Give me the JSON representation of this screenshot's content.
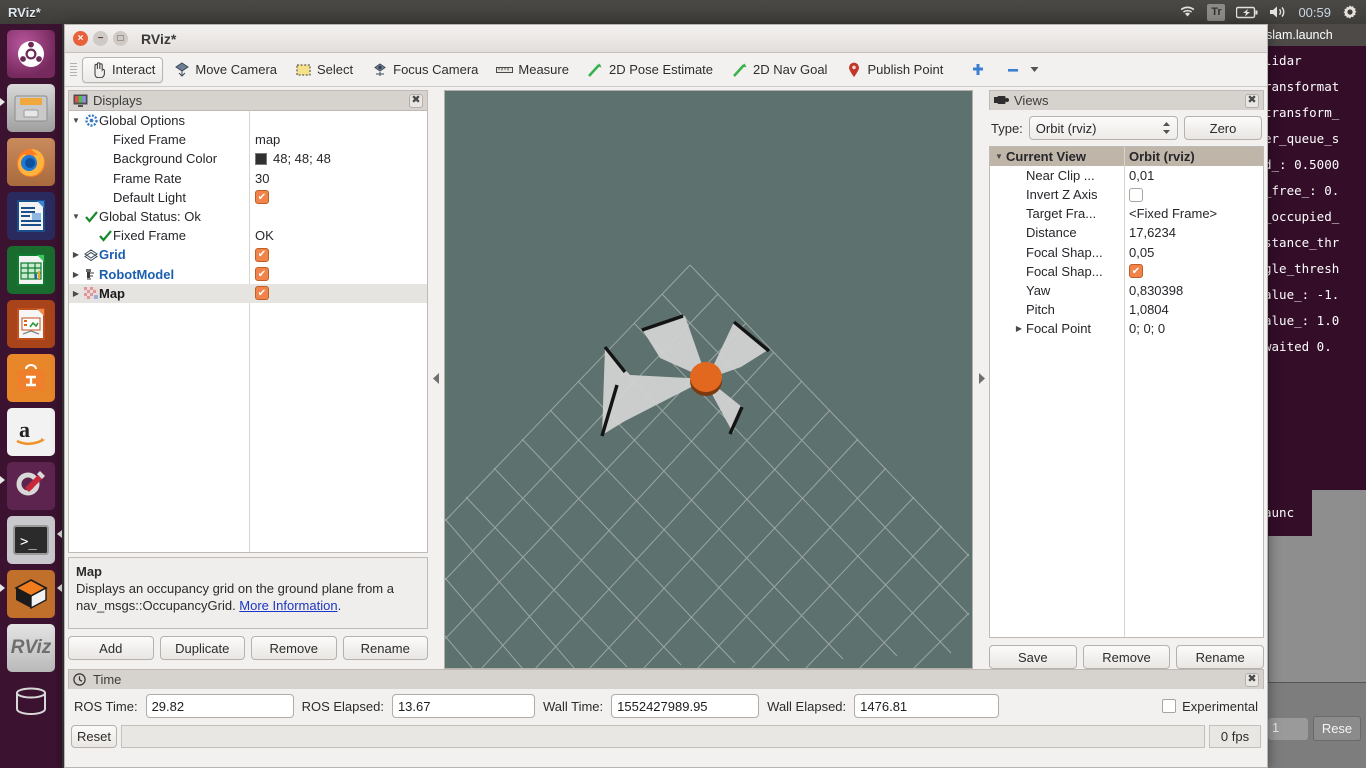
{
  "top_panel": {
    "app_title": "RViz*",
    "clock": "00:59",
    "indicators": [
      "wifi-icon",
      "keyboard-layout-Tr",
      "battery-icon",
      "volume-icon",
      "gear-icon"
    ],
    "keyboard_layout": "Tr"
  },
  "launcher": {
    "items": [
      {
        "name": "ubuntu-dash",
        "label": "Ubuntu"
      },
      {
        "name": "files",
        "label": "Files"
      },
      {
        "name": "firefox",
        "label": "Firefox"
      },
      {
        "name": "libreoffice-writer",
        "label": "LibreOffice Writer"
      },
      {
        "name": "libreoffice-calc",
        "label": "LibreOffice Calc"
      },
      {
        "name": "libreoffice-impress",
        "label": "LibreOffice Impress"
      },
      {
        "name": "ubuntu-software",
        "label": "Ubuntu Software"
      },
      {
        "name": "amazon",
        "label": "Amazon"
      },
      {
        "name": "system-settings",
        "label": "System Settings"
      },
      {
        "name": "terminal",
        "label": "Terminal"
      },
      {
        "name": "gazebo",
        "label": "Gazebo"
      },
      {
        "name": "rviz",
        "label": "RViz"
      },
      {
        "name": "trash",
        "label": "Trash"
      }
    ]
  },
  "window": {
    "title": "RViz*",
    "buttons": [
      "close",
      "minimize",
      "maximize"
    ]
  },
  "toolbar": {
    "items": [
      {
        "label": "Interact",
        "icon": "hand-cursor-icon",
        "active": true
      },
      {
        "label": "Move Camera",
        "icon": "move-camera-icon",
        "active": false
      },
      {
        "label": "Select",
        "icon": "select-rect-icon",
        "active": false
      },
      {
        "label": "Focus Camera",
        "icon": "focus-camera-icon",
        "active": false
      },
      {
        "label": "Measure",
        "icon": "ruler-icon",
        "active": false
      },
      {
        "label": "2D Pose Estimate",
        "icon": "green-arrow-icon",
        "active": false
      },
      {
        "label": "2D Nav Goal",
        "icon": "green-arrow-icon",
        "active": false
      },
      {
        "label": "Publish Point",
        "icon": "map-pin-icon",
        "active": false
      }
    ],
    "plus_label": "+",
    "minus_label": "−"
  },
  "displays_panel": {
    "title": "Displays",
    "close_label": "✖",
    "rows": [
      {
        "indent": 0,
        "arrow": "▼",
        "icon": "gear-icon",
        "label": "Global Options",
        "label_style": "plain",
        "value_type": "none",
        "value": "",
        "selected": false
      },
      {
        "indent": 1,
        "arrow": "",
        "icon": "none",
        "label": "Fixed Frame",
        "label_style": "plain",
        "value_type": "text",
        "value": "map",
        "selected": false
      },
      {
        "indent": 1,
        "arrow": "",
        "icon": "none",
        "label": "Background Color",
        "label_style": "plain",
        "value_type": "color",
        "value": "48; 48; 48",
        "color": "#303030",
        "selected": false
      },
      {
        "indent": 1,
        "arrow": "",
        "icon": "none",
        "label": "Frame Rate",
        "label_style": "plain",
        "value_type": "text",
        "value": "30",
        "selected": false
      },
      {
        "indent": 1,
        "arrow": "",
        "icon": "none",
        "label": "Default Light",
        "label_style": "plain",
        "value_type": "check",
        "value": "checked",
        "selected": false
      },
      {
        "indent": 0,
        "arrow": "▼",
        "icon": "check-green-icon",
        "label": "Global Status: Ok",
        "label_style": "plain",
        "value_type": "none",
        "value": "",
        "selected": false
      },
      {
        "indent": 1,
        "arrow": "",
        "icon": "check-green-icon",
        "label": "Fixed Frame",
        "label_style": "plain",
        "value_type": "text",
        "value": "OK",
        "selected": false
      },
      {
        "indent": 0,
        "arrow": "▶",
        "icon": "grid-icon",
        "label": "Grid",
        "label_style": "blue",
        "value_type": "check",
        "value": "checked",
        "selected": false
      },
      {
        "indent": 0,
        "arrow": "▶",
        "icon": "robotmodel-icon",
        "label": "RobotModel",
        "label_style": "blue",
        "value_type": "check",
        "value": "checked",
        "selected": false
      },
      {
        "indent": 0,
        "arrow": "▶",
        "icon": "map-grid-icon",
        "label": "Map",
        "label_style": "bold",
        "value_type": "check",
        "value": "checked",
        "selected": true
      }
    ],
    "description": {
      "title": "Map",
      "text_1": "Displays an occupancy grid on the ground plane from a nav_msgs::OccupancyGrid. ",
      "link": "More Information",
      "text_2": "."
    },
    "buttons": [
      "Add",
      "Duplicate",
      "Remove",
      "Rename"
    ]
  },
  "views_panel": {
    "title": "Views",
    "close_label": "✖",
    "type_label": "Type:",
    "type_value": "Orbit (rviz)",
    "zero_label": "Zero",
    "rows": [
      {
        "indent": 0,
        "arrow": "▼",
        "label": "Current View",
        "value": "Orbit (rviz)",
        "header": true,
        "value_type": "text"
      },
      {
        "indent": 1,
        "arrow": "",
        "label": "Near Clip ...",
        "value": "0,01",
        "header": false,
        "value_type": "text"
      },
      {
        "indent": 1,
        "arrow": "",
        "label": "Invert Z Axis",
        "value": "",
        "header": false,
        "value_type": "check-off"
      },
      {
        "indent": 1,
        "arrow": "",
        "label": "Target Fra...",
        "value": "<Fixed Frame>",
        "header": false,
        "value_type": "text"
      },
      {
        "indent": 1,
        "arrow": "",
        "label": "Distance",
        "value": "17,6234",
        "header": false,
        "value_type": "text"
      },
      {
        "indent": 1,
        "arrow": "",
        "label": "Focal Shap...",
        "value": "0,05",
        "header": false,
        "value_type": "text"
      },
      {
        "indent": 1,
        "arrow": "",
        "label": "Focal Shap...",
        "value": "",
        "header": false,
        "value_type": "check"
      },
      {
        "indent": 1,
        "arrow": "",
        "label": "Yaw",
        "value": "0,830398",
        "header": false,
        "value_type": "text"
      },
      {
        "indent": 1,
        "arrow": "",
        "label": "Pitch",
        "value": "1,0804",
        "header": false,
        "value_type": "text"
      },
      {
        "indent": 1,
        "arrow": "▶",
        "label": "Focal Point",
        "value": "0; 0; 0",
        "header": false,
        "value_type": "text"
      }
    ],
    "buttons": [
      "Save",
      "Remove",
      "Rename"
    ]
  },
  "time_panel": {
    "title": "Time",
    "close_label": "✖",
    "fields": [
      {
        "label": "ROS Time:",
        "value": "29.82"
      },
      {
        "label": "ROS Elapsed:",
        "value": "13.67"
      },
      {
        "label": "Wall Time:",
        "value": "1552427989.95"
      },
      {
        "label": "Wall Elapsed:",
        "value": "1476.81"
      }
    ],
    "experimental_label": "Experimental",
    "experimental_checked": false,
    "reset_label": "Reset",
    "fps_label": "0 fps"
  },
  "terminal": {
    "tab_title": "slam.launch",
    "lines": [
      "lidar",
      "ransformat",
      "transform_",
      "er_queue_s",
      "d_: 0.5000",
      "_free_: 0.",
      "_occupied_",
      "stance_thr",
      "gle_thresh",
      "alue_: -1.",
      "alue_: 1.0",
      " waited 0."
    ],
    "lower_fragment": "aunc"
  },
  "background_window": {
    "reset_label": "Rese",
    "field_value": "1"
  },
  "colors": {
    "viewport_bg": "#5d716e",
    "grid_line": "#c8cecd",
    "robot_body": "#e2681f",
    "laser_scan": "#d2d2d2",
    "accent_check": "#f0844a",
    "tree_blue": "#1c5fb0",
    "views_header": "#bfb5a8",
    "launcher_bg": "#3b102f",
    "terminal_bg": "#340d29"
  }
}
